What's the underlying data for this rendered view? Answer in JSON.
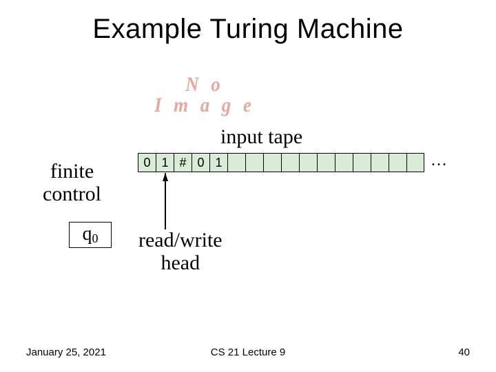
{
  "title": "Example Turing Machine",
  "no_image_top": "N o",
  "no_image_bottom": "I m a g e",
  "input_tape_label": "input tape",
  "tape_cells": [
    "0",
    "1",
    "#",
    "0",
    "1",
    "",
    "",
    "",
    "",
    "",
    "",
    "",
    "",
    "",
    "",
    ""
  ],
  "ellipsis": "…",
  "finite_control_label_1": "finite",
  "finite_control_label_2": "control",
  "state_symbol": "q",
  "state_sub": "0",
  "rw_head_label_1": "read/write",
  "rw_head_label_2": "head",
  "footer_date": "January 25, 2021",
  "footer_center": "CS 21 Lecture 9",
  "footer_page": "40"
}
